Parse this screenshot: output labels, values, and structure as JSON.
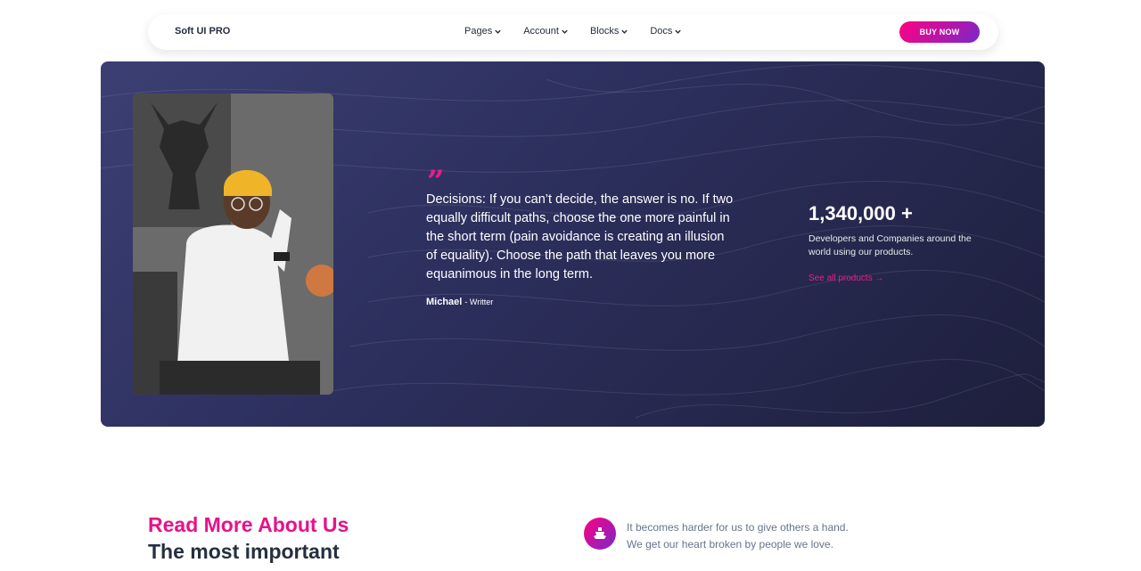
{
  "navbar": {
    "brand": "Soft UI PRO",
    "links": [
      "Pages",
      "Account",
      "Blocks",
      "Docs"
    ],
    "buy_label": "BUY NOW"
  },
  "hero": {
    "quote_mark": "”",
    "quote": "Decisions: If you can’t decide, the answer is no. If two equally difficult paths, choose the one more painful in the short term (pain avoidance is creating an illusion of equality). Choose the path that leaves you more equanimous in the long term.",
    "author_name": "Michael",
    "author_role": "- Writter",
    "stat_number": "1,340,000 +",
    "stat_description": "Developers and Companies around the world using our products.",
    "stat_link": "See all products →"
  },
  "section": {
    "heading_accent": "Read More About Us",
    "heading_main": "The most important",
    "feature_line1": "It becomes harder for us to give others a hand.",
    "feature_line2": "We get our heart broken by people we love.",
    "feature_icon": "ship-icon"
  },
  "colors": {
    "accent_pink": "#e6128a",
    "gradient_start": "#7928ca",
    "gradient_end": "#ff0080",
    "hero_bg": "#2c2f5c"
  }
}
